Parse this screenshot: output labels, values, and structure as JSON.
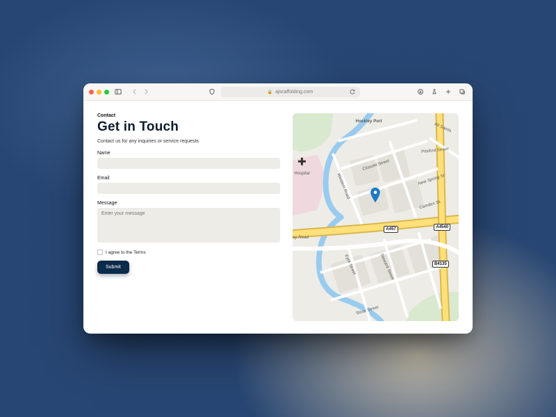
{
  "browser": {
    "url": "ajscaffolding.com"
  },
  "page": {
    "eyebrow": "Contact",
    "title": "Get in Touch",
    "subtitle": "Contact us for any inquiries or service requests"
  },
  "form": {
    "name_label": "Name",
    "name_value": "",
    "email_label": "Email",
    "email_value": "",
    "message_label": "Message",
    "message_placeholder": "Enter your message",
    "message_value": "",
    "terms_label": "I agree to the Terms",
    "terms_checked": false,
    "submit_label": "Submit"
  },
  "map": {
    "labels": {
      "hockley_port": "Hockley Port",
      "all_saints": "All Saints",
      "pitsford": "Pitsford Street",
      "clissold": "Clissold Street",
      "new_spring": "New Spring St",
      "camden": "Camden St.",
      "western": "Western Road",
      "hospital": "Hospital",
      "ew_road": "ey Road",
      "eyre": "Eyre Street",
      "steward": "Steward Street",
      "stour": "Stour Street"
    },
    "roads": {
      "a457": "A457",
      "a4540": "A4540",
      "b4135": "B4135"
    }
  }
}
